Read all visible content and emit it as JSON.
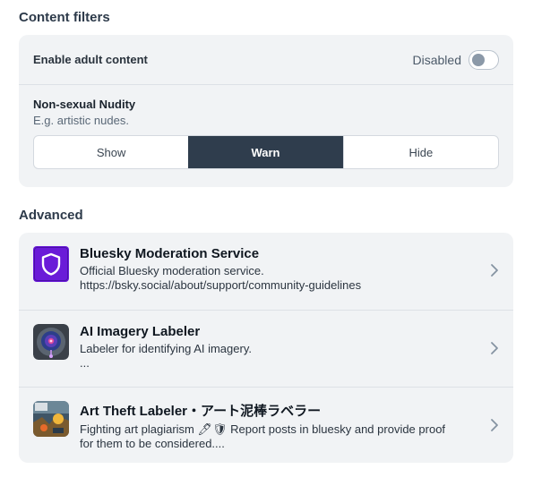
{
  "content_filters": {
    "heading": "Content filters",
    "adult": {
      "label": "Enable adult content",
      "status": "Disabled"
    },
    "nudity": {
      "title": "Non-sexual Nudity",
      "description": "E.g. artistic nudes.",
      "options": [
        "Show",
        "Warn",
        "Hide"
      ],
      "selected": "Warn"
    }
  },
  "advanced": {
    "heading": "Advanced",
    "labelers": [
      {
        "name": "Bluesky Moderation Service",
        "line1": "Official Bluesky moderation service.",
        "line2": "https://bsky.social/about/support/community-guidelines",
        "icon": "shield-icon"
      },
      {
        "name": "AI Imagery Labeler",
        "line1": "Labeler for identifying AI imagery.",
        "line2": "...",
        "icon": "ai-labeler-avatar"
      },
      {
        "name": "Art Theft Labeler・アート泥棒ラベラー",
        "line1": "Fighting art plagiarism 🖊🛡 Report posts in bluesky and provide proof",
        "line2": "for them to be considered....",
        "icon": "art-theft-avatar"
      }
    ]
  },
  "colors": {
    "accent_dark": "#2f3d4d",
    "bluesky_purple": "#6a1bd8",
    "card_bg": "#f1f3f5"
  }
}
